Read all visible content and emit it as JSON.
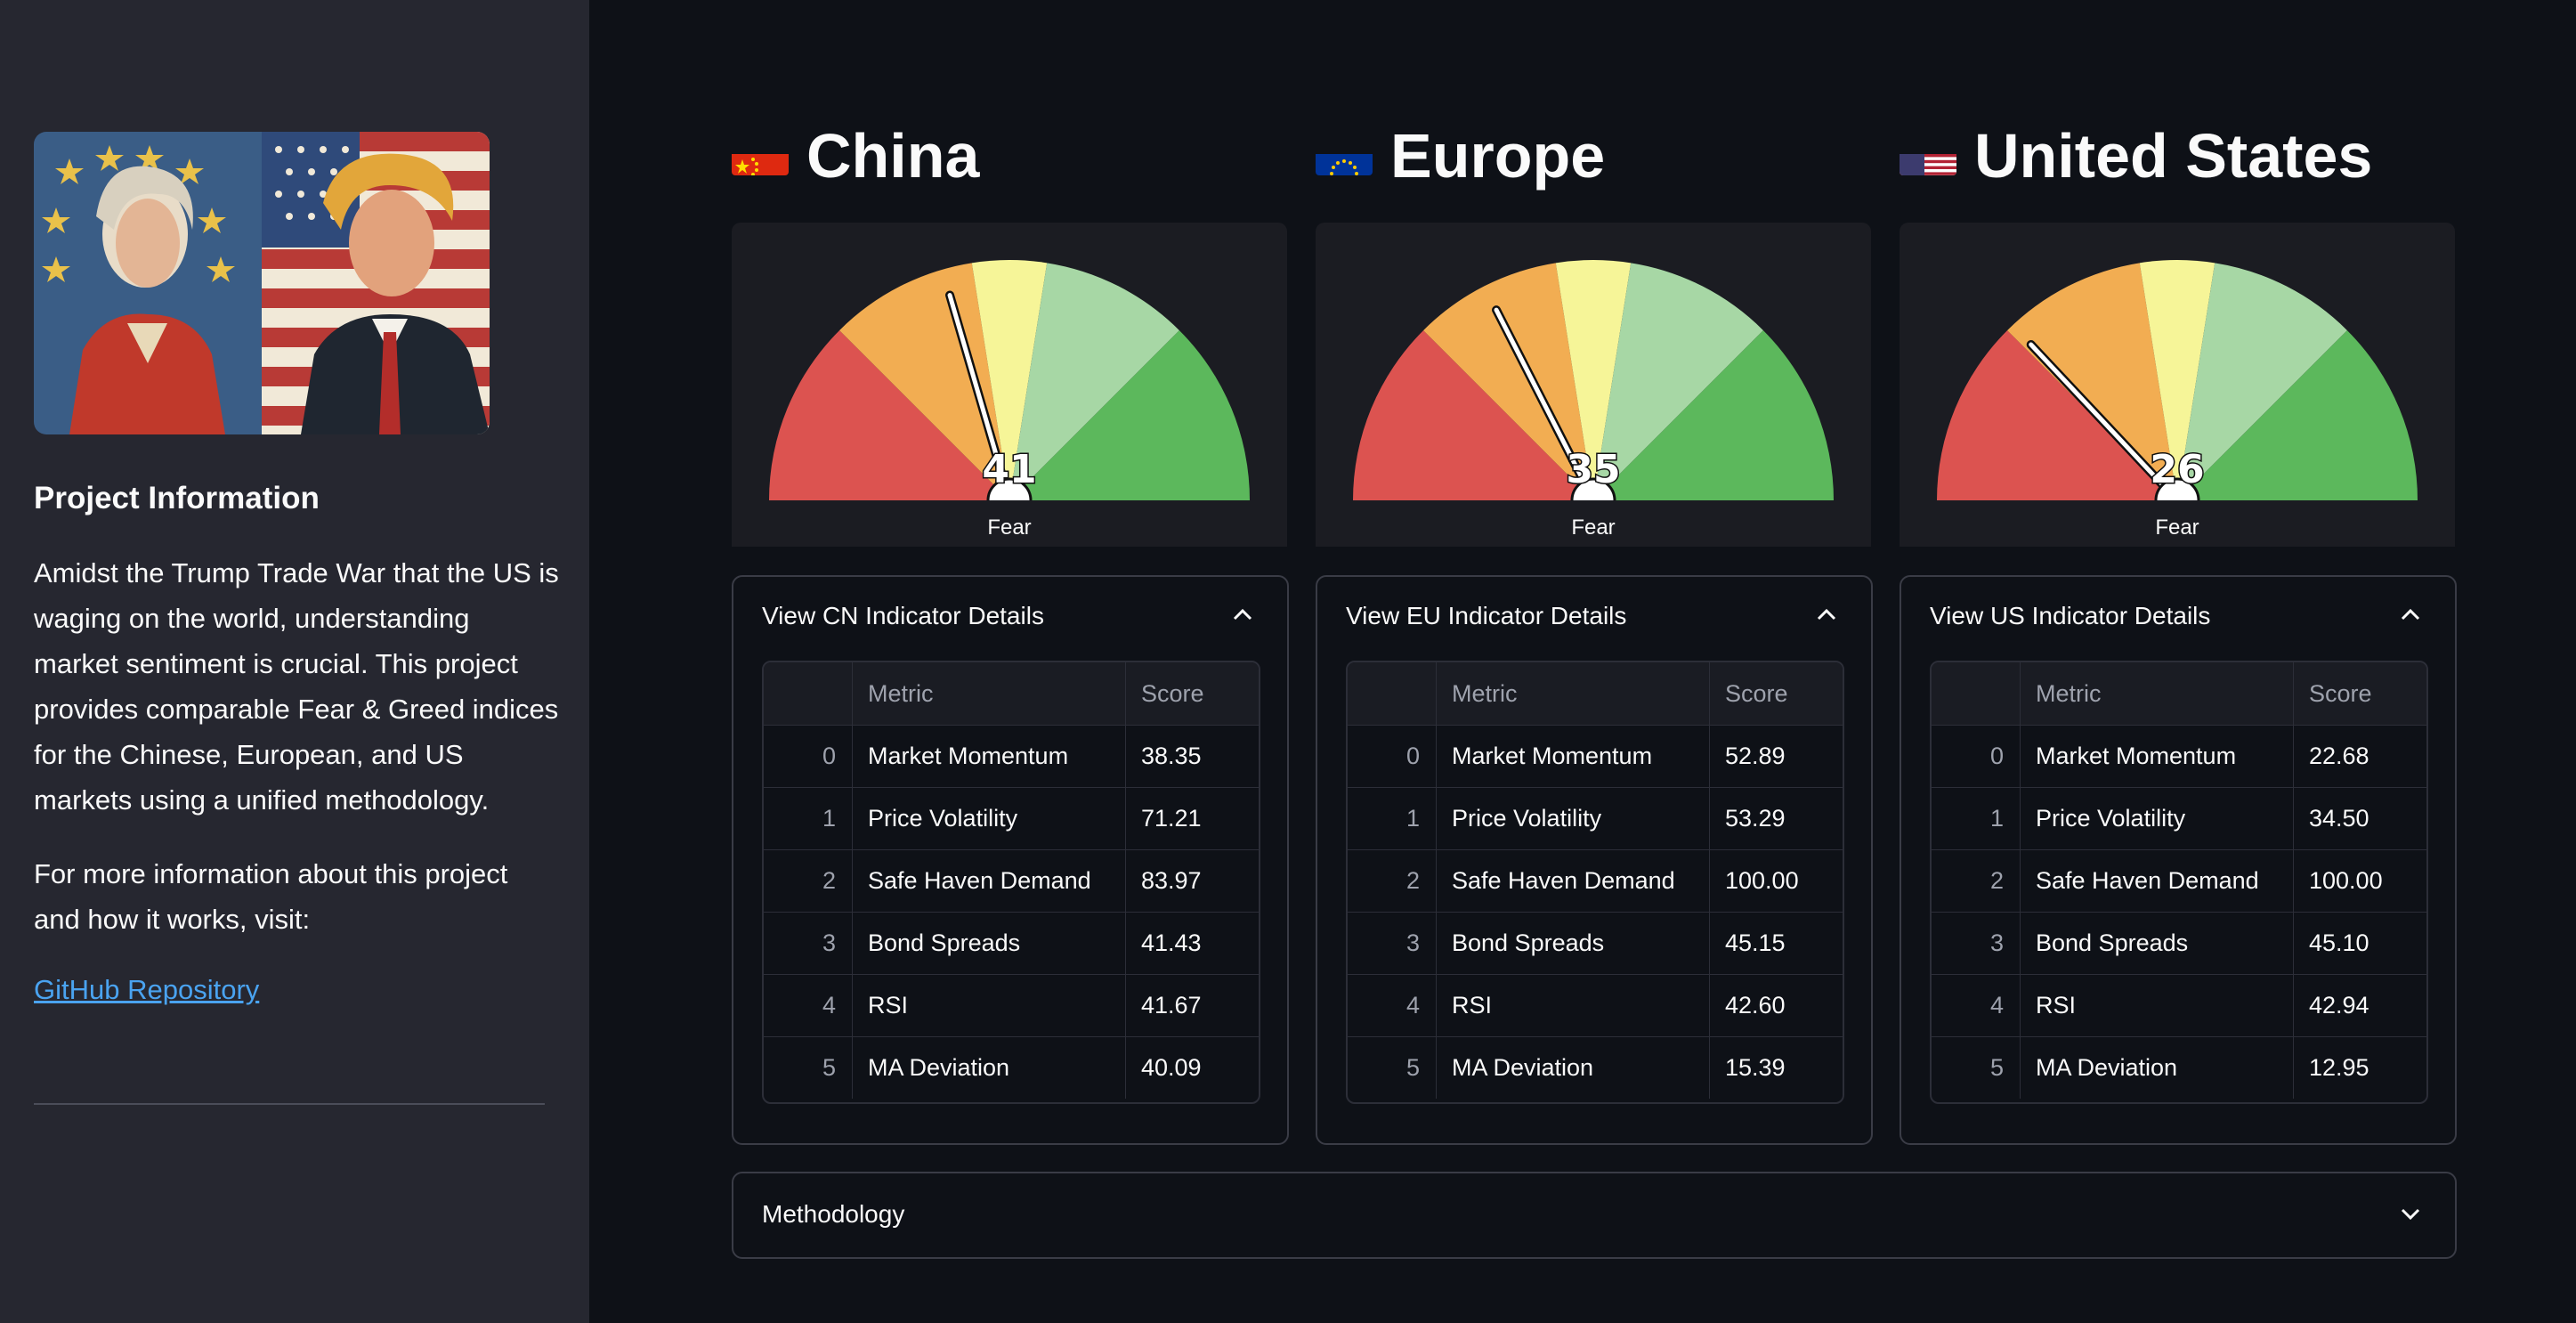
{
  "sidebar": {
    "title": "Project Information",
    "description": "Amidst the Trump Trade War that the US is waging on the world, understanding market sentiment is crucial. This project provides comparable Fear & Greed indices for the Chinese, European, and US markets using a unified methodology.",
    "more_info": "For more information about this project and how it works, visit:",
    "link_label": "GitHub Repository"
  },
  "colors": {
    "extreme_fear": "#dc5350",
    "fear": "#f2ad52",
    "neutral": "#f6f598",
    "greed": "#a7d7a5",
    "extreme_greed": "#5cb85c",
    "link": "#4aa3f0"
  },
  "table_headers": {
    "index": "",
    "metric": "Metric",
    "score": "Score"
  },
  "markets": [
    {
      "name": "China",
      "flag": "cn-flag",
      "gauge_value": 41,
      "gauge_value_label": "41",
      "gauge_label": "Fear",
      "details_label": "View CN Indicator Details",
      "rows": [
        {
          "index": "0",
          "metric": "Market Momentum",
          "score": "38.35"
        },
        {
          "index": "1",
          "metric": "Price Volatility",
          "score": "71.21"
        },
        {
          "index": "2",
          "metric": "Safe Haven Demand",
          "score": "83.97"
        },
        {
          "index": "3",
          "metric": "Bond Spreads",
          "score": "41.43"
        },
        {
          "index": "4",
          "metric": "RSI",
          "score": "41.67"
        },
        {
          "index": "5",
          "metric": "MA Deviation",
          "score": "40.09"
        }
      ]
    },
    {
      "name": "Europe",
      "flag": "eu-flag",
      "gauge_value": 35,
      "gauge_value_label": "35",
      "gauge_label": "Fear",
      "details_label": "View EU Indicator Details",
      "rows": [
        {
          "index": "0",
          "metric": "Market Momentum",
          "score": "52.89"
        },
        {
          "index": "1",
          "metric": "Price Volatility",
          "score": "53.29"
        },
        {
          "index": "2",
          "metric": "Safe Haven Demand",
          "score": "100.00"
        },
        {
          "index": "3",
          "metric": "Bond Spreads",
          "score": "45.15"
        },
        {
          "index": "4",
          "metric": "RSI",
          "score": "42.60"
        },
        {
          "index": "5",
          "metric": "MA Deviation",
          "score": "15.39"
        }
      ]
    },
    {
      "name": "United States",
      "flag": "us-flag",
      "gauge_value": 26,
      "gauge_value_label": "26",
      "gauge_label": "Fear",
      "details_label": "View US Indicator Details",
      "rows": [
        {
          "index": "0",
          "metric": "Market Momentum",
          "score": "22.68"
        },
        {
          "index": "1",
          "metric": "Price Volatility",
          "score": "34.50"
        },
        {
          "index": "2",
          "metric": "Safe Haven Demand",
          "score": "100.00"
        },
        {
          "index": "3",
          "metric": "Bond Spreads",
          "score": "45.10"
        },
        {
          "index": "4",
          "metric": "RSI",
          "score": "42.94"
        },
        {
          "index": "5",
          "metric": "MA Deviation",
          "score": "12.95"
        }
      ]
    }
  ],
  "methodology_label": "Methodology"
}
